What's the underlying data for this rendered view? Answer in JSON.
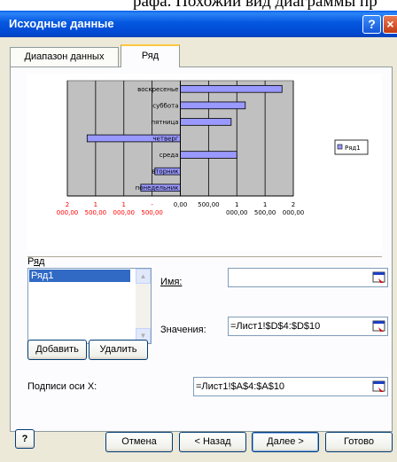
{
  "caption_strip": "рафа. Похожий вид диаграммы пр",
  "window": {
    "title": "Исходные данные",
    "help_glyph": "?",
    "close_glyph": "×"
  },
  "tabs": [
    {
      "label": "Диапазон данных"
    },
    {
      "label": "Ряд"
    }
  ],
  "chart_data": {
    "type": "bar",
    "orientation": "horizontal",
    "categories": [
      "понедельник",
      "вторник",
      "среда",
      "четверг",
      "пятница",
      "суббота",
      "воскресенье"
    ],
    "series": [
      {
        "name": "Ряд1",
        "values": [
          -700,
          -450,
          1000,
          -1650,
          900,
          1150,
          1800
        ]
      }
    ],
    "xlim": [
      -2000,
      2000
    ],
    "tick_values": [
      -2000,
      -1500,
      -1000,
      -500,
      0,
      500,
      1000,
      1500,
      2000
    ],
    "tick_labels": [
      [
        "2",
        "000,00"
      ],
      [
        "1",
        "500,00"
      ],
      [
        "1",
        "000,00"
      ],
      [
        "-",
        "500,00"
      ],
      [
        "0,00",
        ""
      ],
      [
        "500,00",
        ""
      ],
      [
        "1",
        "000,00"
      ],
      [
        "1",
        "500,00"
      ],
      [
        "2",
        "000,00"
      ]
    ],
    "negative_tick_color": "#ff0000",
    "plot_color": "#c0c0c0",
    "bar_color": "#9999ff",
    "legend": "right",
    "grid": true
  },
  "series_section": {
    "label_prefix": "Р",
    "label_underlined": "я",
    "label_suffix": "д",
    "items": [
      "Ряд1"
    ],
    "name_label": "Имя:",
    "values_label": "Значения:",
    "name_value": "",
    "values_value": "=Лист1!$D$4:$D$10",
    "add_button": "Добавить",
    "remove_button": "Удалить"
  },
  "x_labels": {
    "label": "Подписи оси X:",
    "value": "=Лист1!$A$4:$A$10"
  },
  "footer": {
    "help_glyph": "?",
    "cancel": "Отмена",
    "back": "< Назад",
    "next": "Далее >",
    "finish": "Готово"
  },
  "colors": {
    "titlebar": "#0457e0",
    "dialog_bg": "#ece9d8",
    "tab_highlight": "#ffc73c",
    "selection": "#316ac5"
  }
}
